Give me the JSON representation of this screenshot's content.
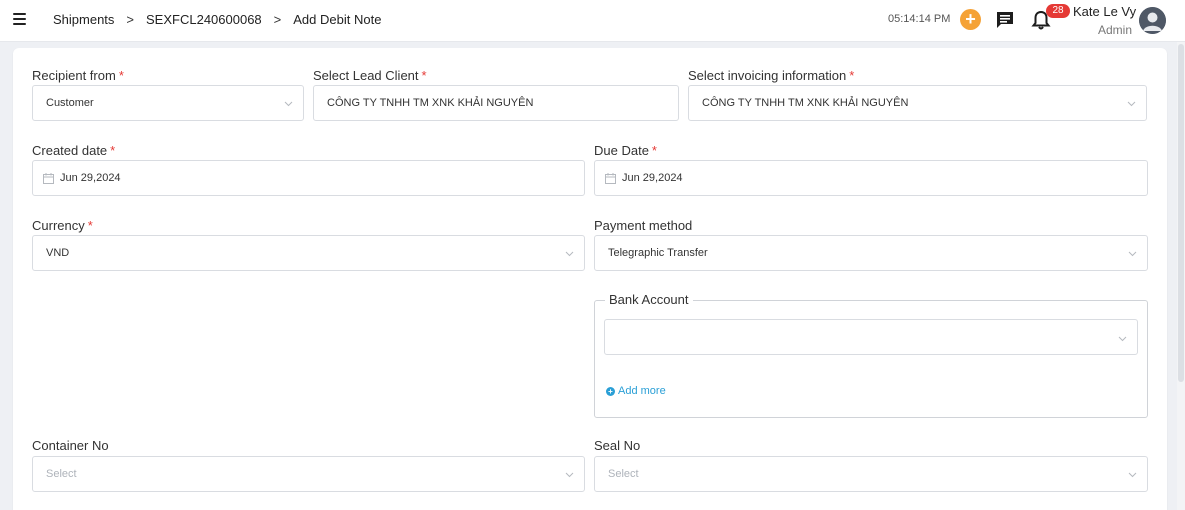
{
  "header": {
    "breadcrumbs": [
      "Shipments",
      "SEXFCL240600068",
      "Add Debit Note"
    ],
    "separator": ">",
    "clock": "05:14:14 PM",
    "plus_symbol": "+",
    "notification_count": "28",
    "user_name": "Kate Le Vy",
    "user_role": "Admin"
  },
  "form": {
    "required_mark": "*",
    "recipient_from": {
      "label": "Recipient from",
      "value": "Customer"
    },
    "lead_client": {
      "label": "Select Lead Client",
      "value": "CÔNG TY TNHH TM XNK KHẢI NGUYÊN"
    },
    "invoicing_info": {
      "label": "Select invoicing information",
      "value": "CÔNG TY TNHH TM XNK KHẢI NGUYÊN"
    },
    "created_date": {
      "label": "Created date",
      "value": "Jun 29,2024"
    },
    "due_date": {
      "label": "Due Date",
      "value": "Jun 29,2024"
    },
    "currency": {
      "label": "Currency",
      "value": "VND"
    },
    "payment_method": {
      "label": "Payment method",
      "value": "Telegraphic Transfer"
    },
    "bank_account": {
      "legend": "Bank Account",
      "value": "",
      "add_more": "Add more"
    },
    "container_no": {
      "label": "Container No",
      "placeholder": "Select"
    },
    "seal_no": {
      "label": "Seal No",
      "placeholder": "Select"
    }
  },
  "colors": {
    "accent_orange": "#f5a236",
    "required_red": "#e53935",
    "link_blue": "#2a9fd6"
  }
}
